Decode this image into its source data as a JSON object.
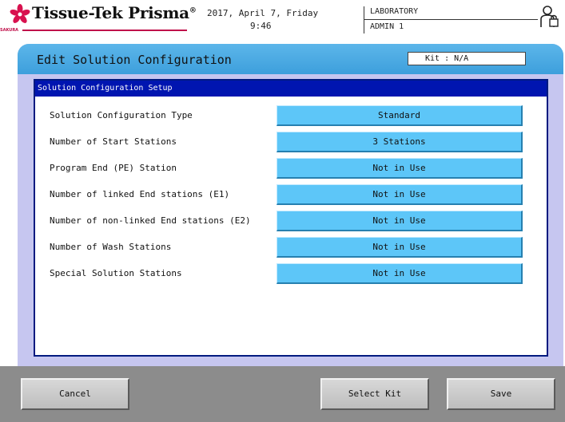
{
  "header": {
    "logo_text": "Tissue-Tek Prisma",
    "logo_reg": "®",
    "logo_sub": "SAKURA",
    "date": "2017, April 7, Friday",
    "time": "9:46",
    "location": "LABORATORY",
    "user": "ADMIN 1",
    "brand_color": "#c0104a"
  },
  "title_bar": {
    "title": "Edit Solution Configuration",
    "kit": "Kit : N/A"
  },
  "setup": {
    "header": "Solution Configuration Setup",
    "rows": [
      {
        "label": "Solution Configuration Type",
        "value": "Standard"
      },
      {
        "label": "Number of Start Stations",
        "value": "3 Stations"
      },
      {
        "label": "Program End (PE) Station",
        "value": "Not in Use"
      },
      {
        "label": "Number of linked End stations (E1)",
        "value": "Not in Use"
      },
      {
        "label": "Number of non-linked End stations (E2)",
        "value": "Not in Use"
      },
      {
        "label": "Number of Wash Stations",
        "value": "Not in Use"
      },
      {
        "label": "Special Solution Stations",
        "value": "Not in Use"
      }
    ]
  },
  "footer": {
    "cancel": "Cancel",
    "select_kit": "Select Kit",
    "save": "Save"
  },
  "colors": {
    "title_bar": "#3d9fdc",
    "panel_bg": "#c6c6f0",
    "section_header": "#0015b0",
    "value_button": "#5dc6f8",
    "footer_bg": "#8c8c8c"
  },
  "icons": {
    "logo": "sakura-flower-icon",
    "user": "user-lock-icon"
  }
}
